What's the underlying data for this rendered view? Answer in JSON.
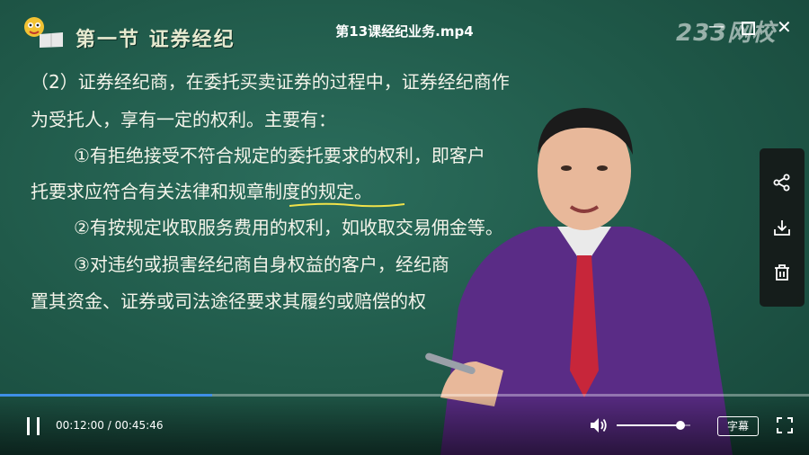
{
  "player": {
    "title": "第13课经纪业务.mp4",
    "brand": "233网校",
    "window": {
      "minimize": "—",
      "close": "✕"
    },
    "current_time": "00:12:00",
    "separator": " / ",
    "duration": "00:45:46",
    "progress_fraction": 0.2622,
    "volume_fraction": 0.86,
    "subtitle_label": "字幕",
    "accent_color": "#3f8fe6"
  },
  "side_panel": {
    "icons": [
      "share-icon",
      "download-icon",
      "delete-icon"
    ]
  },
  "lesson": {
    "section_title": "第一节  证券经纪",
    "lines": [
      "（2）证券经纪商，在委托买卖证券的过程中，证券经纪商作",
      "为受托人，享有一定的权利。主要有：",
      "①有拒绝接受不符合规定的委托要求的权利，即客户",
      "托要求应符合有关法律和规章制度的规定。",
      "②有按规定收取服务费用的权利，如收取交易佣金等。",
      "③对违约或损害经纪商自身权益的客户，经纪商",
      "置其资金、证券或司法途径要求其履约或赔偿的权"
    ]
  }
}
